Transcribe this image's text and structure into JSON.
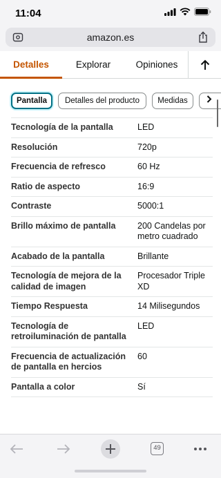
{
  "status": {
    "time": "11:04"
  },
  "browser": {
    "url": "amazon.es",
    "open_tabs": "49"
  },
  "tabs": [
    {
      "label": "Detalles",
      "selected": true
    },
    {
      "label": "Explorar",
      "selected": false
    },
    {
      "label": "Opiniones",
      "selected": false
    }
  ],
  "chips": [
    {
      "label": "Pantalla",
      "selected": true
    },
    {
      "label": "Detalles del producto",
      "selected": false
    },
    {
      "label": "Medidas",
      "selected": false
    }
  ],
  "specs": [
    {
      "label": "Tecnología de la pantalla",
      "value": "LED"
    },
    {
      "label": "Resolución",
      "value": "720p"
    },
    {
      "label": "Frecuencia de refresco",
      "value": "60 Hz"
    },
    {
      "label": "Ratio de aspecto",
      "value": "16:9"
    },
    {
      "label": "Contraste",
      "value": "5000:1"
    },
    {
      "label": "Brillo máximo de pantalla",
      "value": "200 Candelas por metro cuadrado"
    },
    {
      "label": "Acabado de la pantalla",
      "value": "Brillante"
    },
    {
      "label": "Tecnología de mejora de la calidad de imagen",
      "value": "Procesador Triple XD"
    },
    {
      "label": "Tiempo Respuesta",
      "value": "14 Milisegundos"
    },
    {
      "label": "Tecnología de retroiluminación de pantalla",
      "value": "LED"
    },
    {
      "label": "Frecuencia de actualización de pantalla en hercios",
      "value": "60"
    },
    {
      "label": "Pantalla a color",
      "value": "Sí"
    }
  ],
  "colors": {
    "accent": "#c45500",
    "chip_selected_border": "#007185"
  }
}
